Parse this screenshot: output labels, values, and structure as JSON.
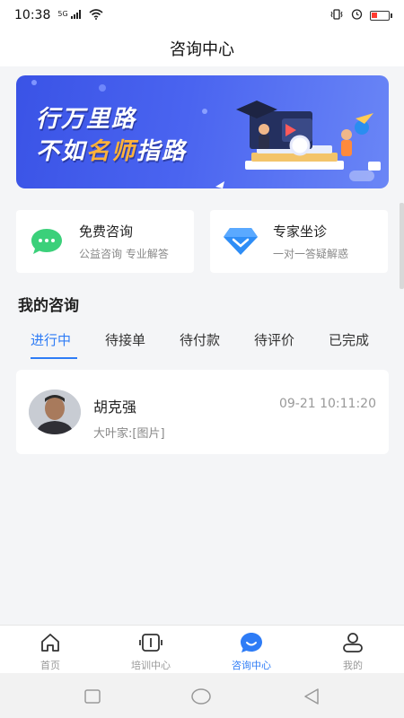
{
  "status": {
    "time": "10:38",
    "net": "5G",
    "colors": {
      "battery_low": "#ff3b30"
    }
  },
  "header": {
    "title": "咨询中心"
  },
  "banner": {
    "line1": "行万里路",
    "line2_part1": "不如",
    "line2_highlight": "名师",
    "line2_part2": "指路"
  },
  "cards": [
    {
      "title": "免费咨询",
      "subtitle": "公益咨询 专业解答",
      "icon": "chat-bubble-icon",
      "color": "#3bd07a"
    },
    {
      "title": "专家坐诊",
      "subtitle": "一对一答疑解惑",
      "icon": "diamond-icon",
      "color": "#2e8df6"
    }
  ],
  "section": {
    "title": "我的咨询"
  },
  "tabs": [
    {
      "label": "进行中",
      "active": true
    },
    {
      "label": "待接单",
      "active": false
    },
    {
      "label": "待付款",
      "active": false
    },
    {
      "label": "待评价",
      "active": false
    },
    {
      "label": "已完成",
      "active": false
    }
  ],
  "consultations": [
    {
      "name": "胡克强",
      "time": "09-21 10:11:20",
      "last_message": "大叶家:[图片]"
    }
  ],
  "tabbar": [
    {
      "label": "首页",
      "icon": "home-icon",
      "active": false
    },
    {
      "label": "培训中心",
      "icon": "training-icon",
      "active": false
    },
    {
      "label": "咨询中心",
      "icon": "consult-icon",
      "active": true
    },
    {
      "label": "我的",
      "icon": "profile-icon",
      "active": false
    }
  ],
  "theme": {
    "accent": "#2e7cf6",
    "background": "#f4f5f7"
  }
}
